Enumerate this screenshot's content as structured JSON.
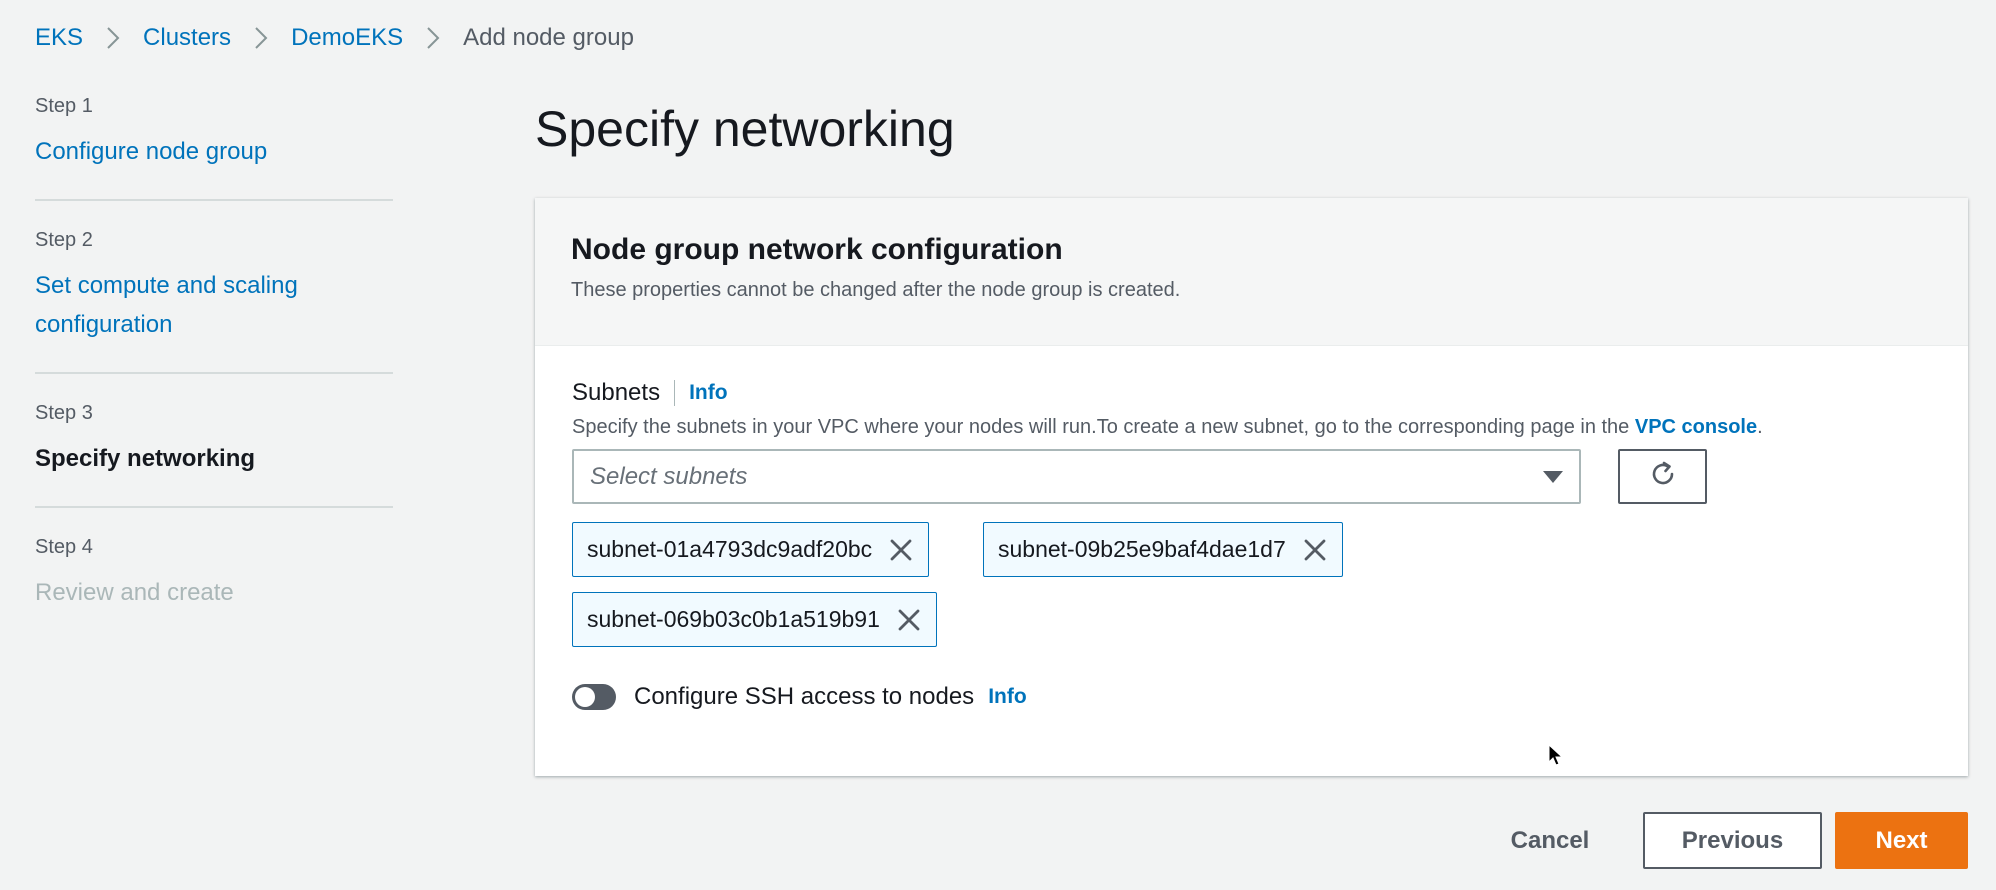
{
  "breadcrumb": {
    "items": [
      "EKS",
      "Clusters",
      "DemoEKS"
    ],
    "current": "Add node group"
  },
  "steps": [
    {
      "number": "Step 1",
      "title": "Configure node group",
      "state": "link"
    },
    {
      "number": "Step 2",
      "title": "Set compute and scaling configuration",
      "state": "link"
    },
    {
      "number": "Step 3",
      "title": "Specify networking",
      "state": "active"
    },
    {
      "number": "Step 4",
      "title": "Review and create",
      "state": "disabled"
    }
  ],
  "page_title": "Specify networking",
  "panel": {
    "title": "Node group network configuration",
    "description": "These properties cannot be changed after the node group is created."
  },
  "subnets": {
    "label": "Subnets",
    "info": "Info",
    "description": "Specify the subnets in your VPC where your nodes will run.To create a new subnet, go to the corresponding page in the",
    "vpc_link": "VPC console",
    "description_end": ".",
    "placeholder": "Select subnets",
    "selected": [
      "subnet-01a4793dc9adf20bc",
      "subnet-09b25e9baf4dae1d7",
      "subnet-069b03c0b1a519b91"
    ]
  },
  "ssh": {
    "label": "Configure SSH access to nodes",
    "info": "Info",
    "enabled": false
  },
  "buttons": {
    "cancel": "Cancel",
    "previous": "Previous",
    "next": "Next"
  },
  "colors": {
    "link": "#0073bb",
    "primary": "#ec7211",
    "background": "#f2f3f3"
  },
  "icons": [
    "chevron-right-icon",
    "caret-down-icon",
    "refresh-icon",
    "close-icon",
    "mouse-cursor-icon"
  ]
}
